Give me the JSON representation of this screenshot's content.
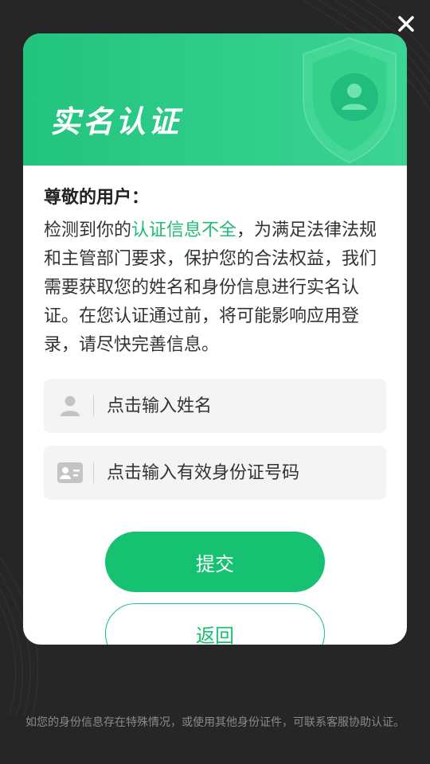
{
  "dialog": {
    "title": "实名认证",
    "greeting": "尊敬的用户：",
    "message_before": "检测到你的",
    "message_highlight": "认证信息不全",
    "message_after": "，为满足法律法规和主管部门要求，保护您的合法权益，我们需要获取您的姓名和身份信息进行实名认证。在您认证通过前，将可能影响应用登录，请尽快完善信息。",
    "name_field": {
      "placeholder": "点击输入姓名",
      "value": "",
      "icon": "user-icon"
    },
    "id_field": {
      "placeholder": "点击输入有效身份证号码",
      "value": "",
      "icon": "id-card-icon"
    },
    "submit_label": "提交",
    "back_label": "返回"
  },
  "footer": {
    "note": "如您的身份信息存在特殊情况，或使用其他身份证件，可联系客服协助认证。"
  },
  "colors": {
    "accent": "#16c272",
    "header_gradient_start": "#22c47e",
    "header_gradient_end": "#3bd494",
    "background": "#262626"
  }
}
